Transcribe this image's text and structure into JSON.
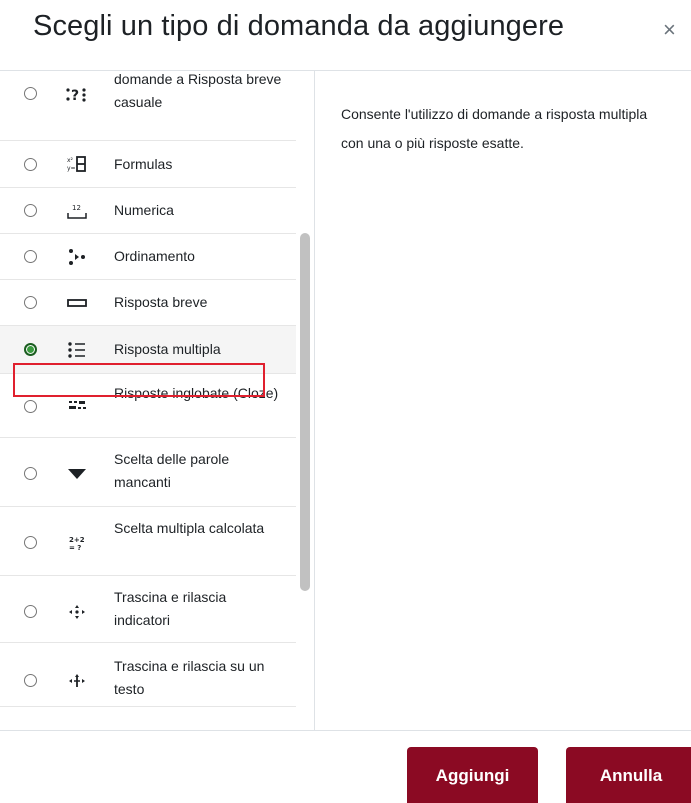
{
  "dialog": {
    "title": "Scegli un tipo di domanda da aggiungere",
    "close_glyph": "×"
  },
  "options": [
    {
      "label": "Corrispondenze con domande a Risposta breve casuale",
      "icon": "random-shortanswer-match-icon",
      "selected": false
    },
    {
      "label": "Formulas",
      "icon": "formulas-icon",
      "selected": false
    },
    {
      "label": "Numerica",
      "icon": "numerical-icon",
      "selected": false
    },
    {
      "label": "Ordinamento",
      "icon": "ordering-icon",
      "selected": false
    },
    {
      "label": "Risposta breve",
      "icon": "short-answer-icon",
      "selected": false
    },
    {
      "label": "Risposta multipla",
      "icon": "multichoice-icon",
      "selected": true
    },
    {
      "label": "Risposte inglobate (Cloze)",
      "icon": "cloze-icon",
      "selected": false
    },
    {
      "label": "Scelta delle parole mancanti",
      "icon": "select-missing-words-icon",
      "selected": false
    },
    {
      "label": "Scelta multipla calcolata",
      "icon": "calculated-multichoice-icon",
      "selected": false
    },
    {
      "label": "Trascina e rilascia indicatori",
      "icon": "drag-drop-markers-icon",
      "selected": false
    },
    {
      "label": "Trascina e rilascia su un testo",
      "icon": "drag-drop-text-icon",
      "selected": false
    }
  ],
  "description": "Consente l'utilizzo di domande a risposta multipla con una o più risposte esatte.",
  "footer": {
    "add_label": "Aggiungi",
    "cancel_label": "Annulla"
  },
  "colors": {
    "primary_button": "#8b0a23",
    "highlight_border": "#e0202e",
    "selected_radio": "#3a9b3f"
  }
}
